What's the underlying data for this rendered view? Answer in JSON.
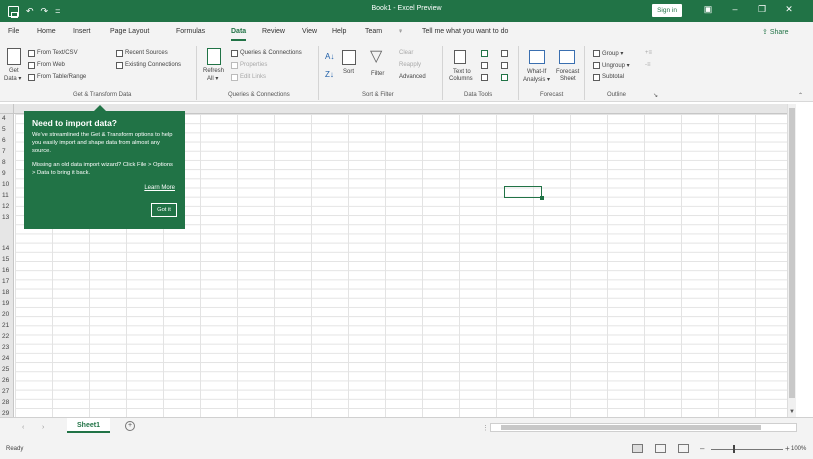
{
  "titlebar": {
    "title": "Book1  -  Excel Preview",
    "signin": "Sign in",
    "qat_undo": "↶",
    "qat_redo": "↷",
    "qat_more": "=",
    "restore": "▣",
    "minimize": "–",
    "maximize": "❐",
    "close": "✕"
  },
  "tabs": {
    "items": [
      "File",
      "Home",
      "Insert",
      "Page Layout",
      "Formulas",
      "Data",
      "Review",
      "View",
      "Help",
      "Team"
    ],
    "active": "Data",
    "tell_me": "Tell me what you want to do",
    "share": "Share"
  },
  "ribbon": {
    "get_data": "Get",
    "get_data2": "Data ▾",
    "from_text_csv": "From Text/CSV",
    "from_web": "From Web",
    "from_table": "From Table/Range",
    "recent_sources": "Recent Sources",
    "existing_connections": "Existing Connections",
    "group_get_transform": "Get & Transform Data",
    "refresh": "Refresh",
    "refresh2": "All ▾",
    "queries_connections": "Queries & Connections",
    "properties": "Properties",
    "edit_links": "Edit Links",
    "group_queries": "Queries & Connections",
    "sort": "Sort",
    "filter": "Filter",
    "clear": "Clear",
    "reapply": "Reapply",
    "advanced": "Advanced",
    "group_sort_filter": "Sort & Filter",
    "text_to_columns": "Text to",
    "text_to_columns2": "Columns",
    "group_data_tools": "Data Tools",
    "what_if": "What-If",
    "what_if2": "Analysis ▾",
    "forecast_sheet": "Forecast",
    "forecast_sheet2": "Sheet",
    "group_forecast": "Forecast",
    "group": "Group ▾",
    "ungroup": "Ungroup ▾",
    "subtotal": "Subtotal",
    "group_outline": "Outline"
  },
  "grid": {
    "rows": [
      "4",
      "5",
      "6",
      "7",
      "8",
      "9",
      "10",
      "11",
      "12",
      "13",
      "14",
      "15",
      "16",
      "17",
      "18",
      "19",
      "20",
      "21",
      "22",
      "23",
      "24",
      "25",
      "26",
      "27",
      "28",
      "29"
    ]
  },
  "callout": {
    "title": "Need to import data?",
    "body": "We've streamlined the Get & Transform options to help you easily import and shape data from almost any source.",
    "body2": "Missing an old data import wizard? Click File > Options > Data to bring it back.",
    "learn_more": "Learn More",
    "got_it": "Got it"
  },
  "sheetbar": {
    "sheet_name": "Sheet1",
    "add": "+"
  },
  "status": {
    "ready": "Ready",
    "zoom": "100%",
    "minus": "–",
    "plus": "+"
  },
  "colors": {
    "accent": "#217346",
    "ribbon_bg": "#f3f3f3"
  }
}
